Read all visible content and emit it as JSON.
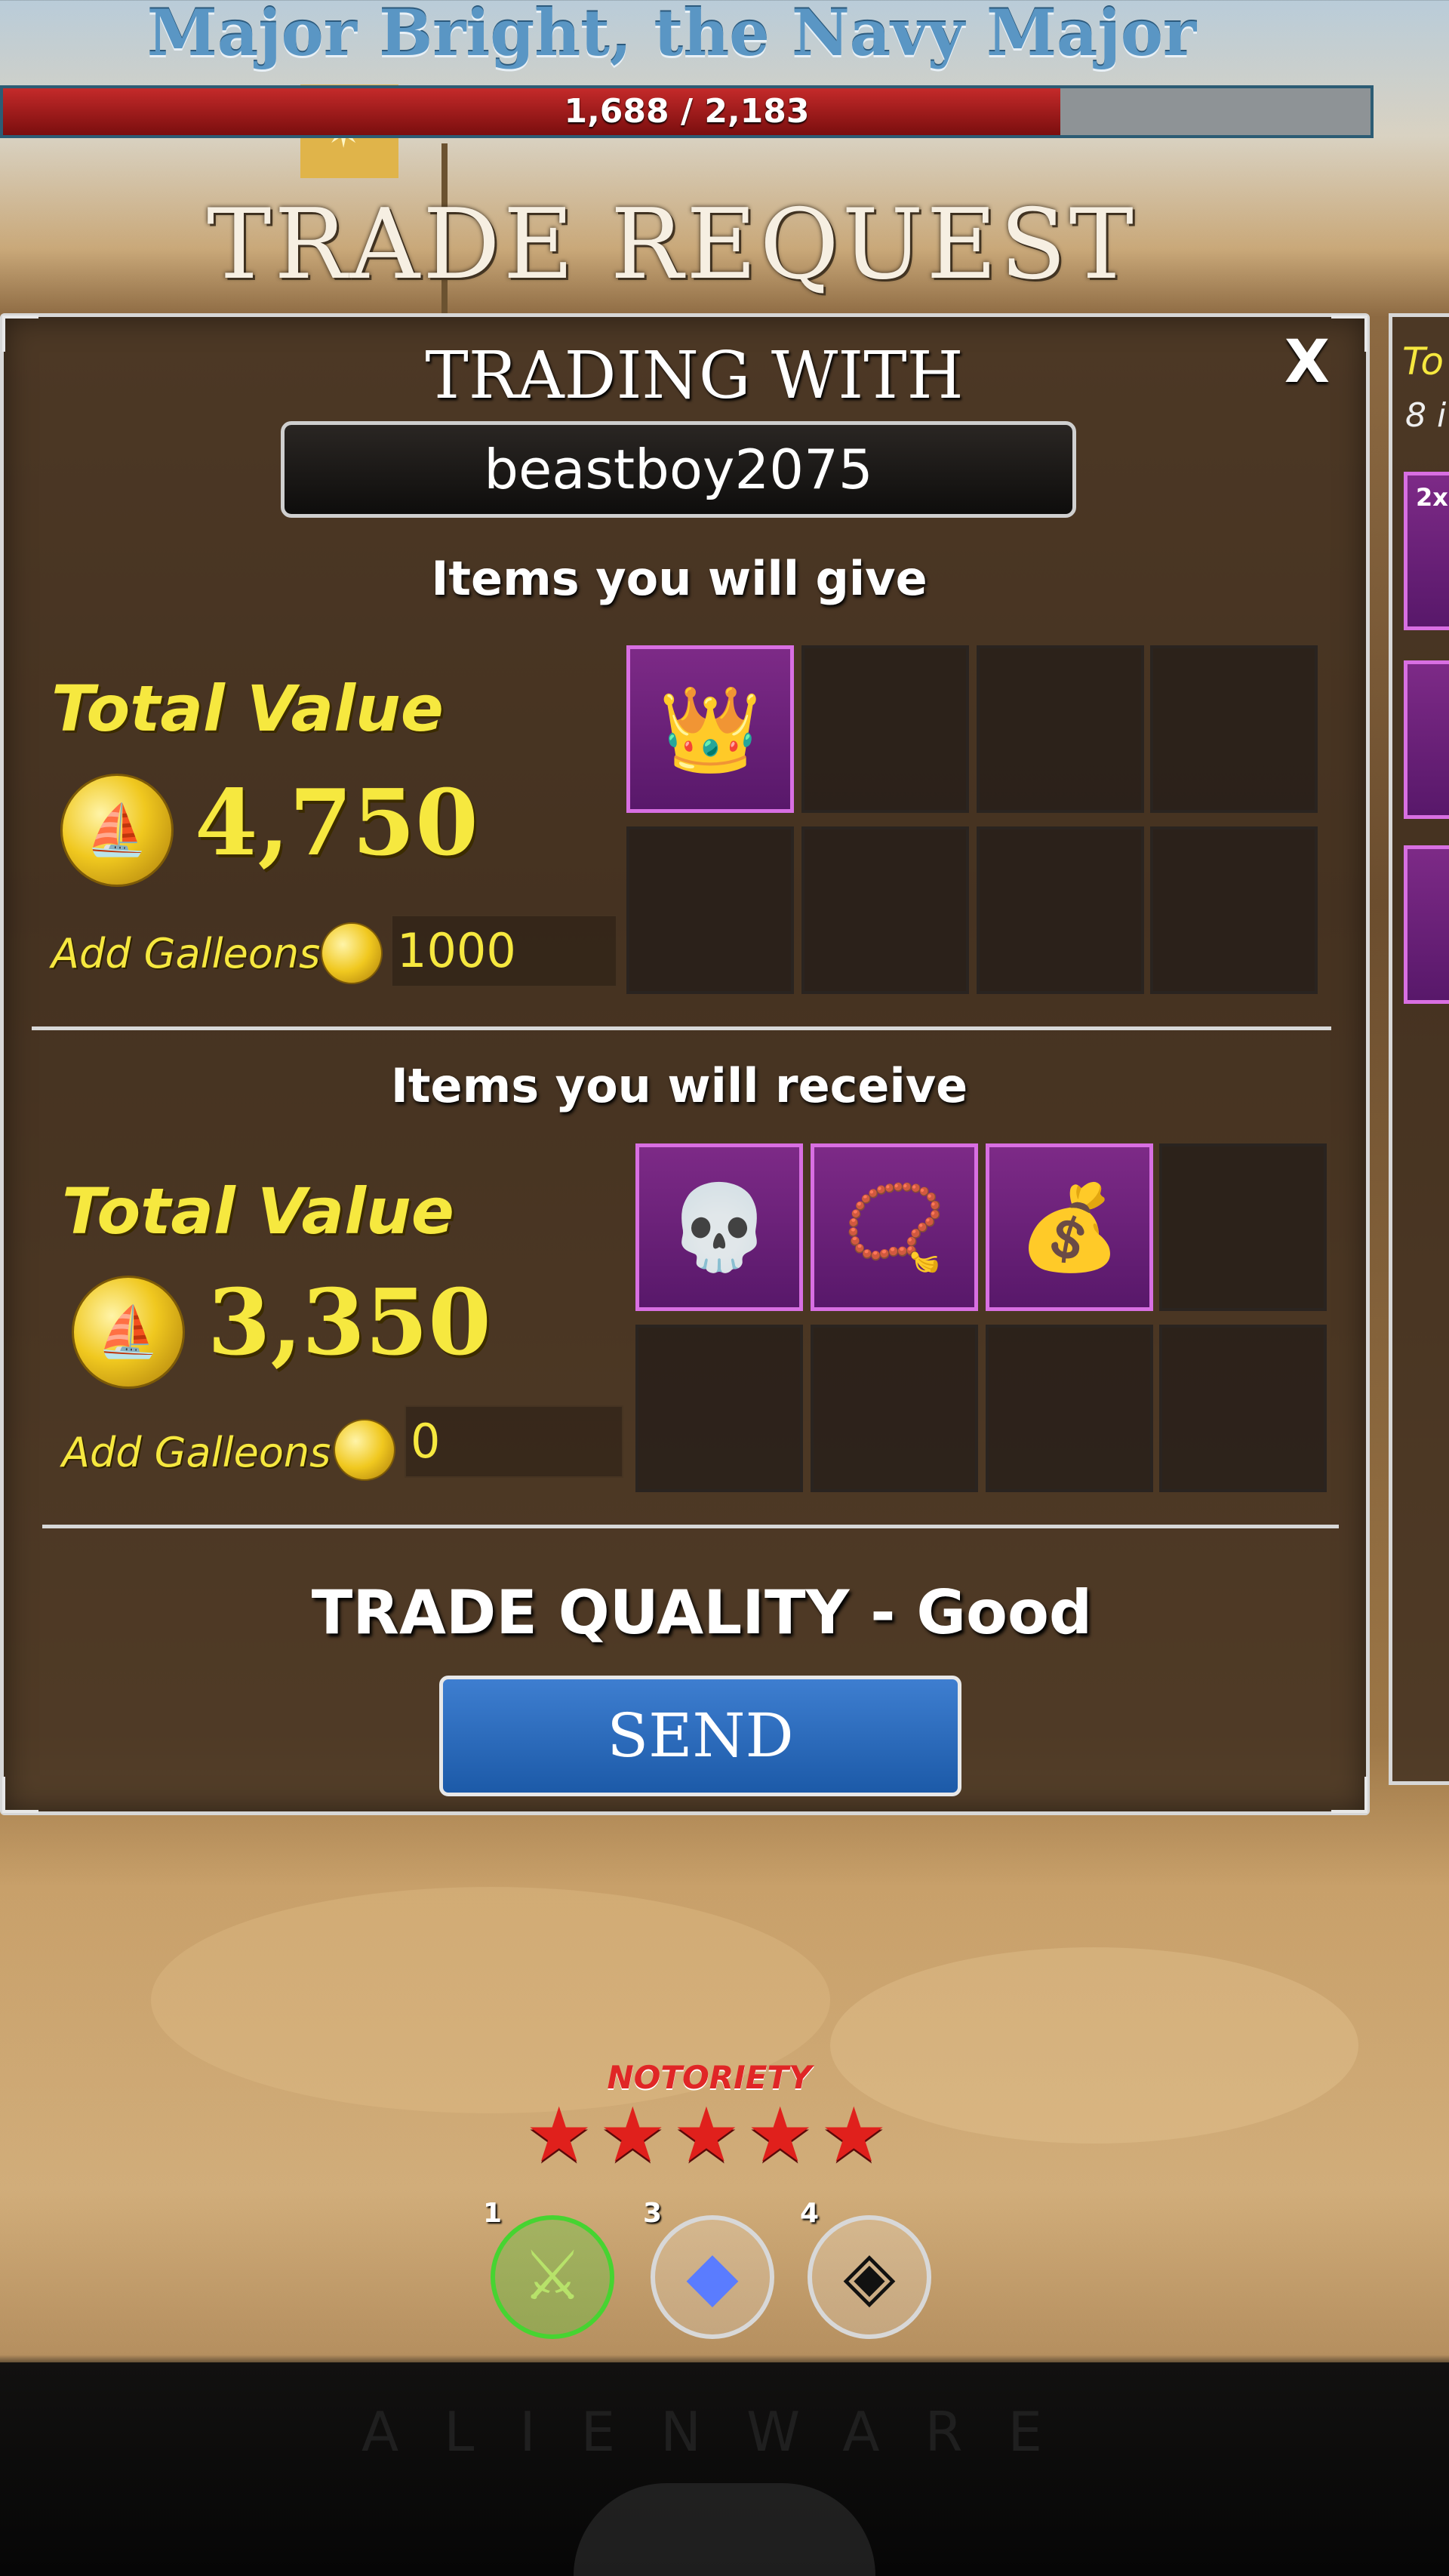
{
  "boss": {
    "name": "Major Bright, the Navy Major",
    "hp_text": "1,688 / 2,183",
    "hp_current": 1688,
    "hp_max": 2183
  },
  "title": "TRADE REQUEST",
  "trade": {
    "trading_with_label": "TRADING WITH",
    "partner": "beastboy2075",
    "close_label": "X",
    "give": {
      "section_label": "Items you will give",
      "total_label": "Total Value",
      "total_value": "4,750",
      "add_galleons_label": "Add Galleons",
      "galleons_value": "1000",
      "slots": [
        {
          "filled": true,
          "icon": "tiara-icon"
        },
        {
          "filled": false
        },
        {
          "filled": false
        },
        {
          "filled": false
        },
        {
          "filled": false
        },
        {
          "filled": false
        },
        {
          "filled": false
        },
        {
          "filled": false
        }
      ]
    },
    "receive": {
      "section_label": "Items you will receive",
      "total_label": "Total Value",
      "total_value": "3,350",
      "add_galleons_label": "Add Galleons",
      "galleons_value": "0",
      "slots": [
        {
          "filled": true,
          "icon": "skull-crown-icon"
        },
        {
          "filled": true,
          "icon": "necklace-icon"
        },
        {
          "filled": true,
          "icon": "coin-pouch-icon"
        },
        {
          "filled": false
        },
        {
          "filled": false
        },
        {
          "filled": false
        },
        {
          "filled": false
        },
        {
          "filled": false
        }
      ]
    },
    "quality_text": "TRADE QUALITY - Good",
    "send_label": "SEND"
  },
  "side_panel": {
    "title_fragment": "To",
    "subtitle_fragment": "8 i",
    "qty_badge": "2x"
  },
  "notoriety": {
    "label": "NOTORIETY",
    "stars": "★★★★★"
  },
  "hotbar": [
    {
      "key": "1",
      "icon": "sword-icon"
    },
    {
      "key": "3",
      "icon": "crystal-icon"
    },
    {
      "key": "4",
      "icon": "vortex-icon"
    }
  ],
  "monitor_brand": "ALIENWARE",
  "colors": {
    "gold_text": "#f6e83f",
    "slot_filled": "#7d2a87",
    "send_button": "#3e7ed0",
    "hp_fill": "#c42a2a"
  }
}
